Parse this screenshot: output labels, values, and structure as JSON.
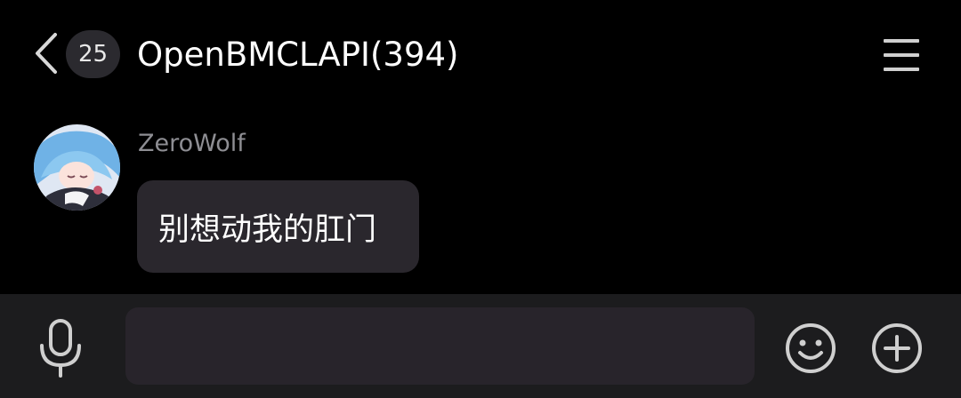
{
  "header": {
    "back_icon": "chevron-left-icon",
    "unread_count": "25",
    "title": "OpenBMCLAPI(394)",
    "menu_icon": "hamburger-menu-icon"
  },
  "messages": [
    {
      "sender": "ZeroWolf",
      "avatar_icon": "avatar-anime-blue-hair",
      "text": "别想动我的肛门"
    }
  ],
  "input_bar": {
    "mic_icon": "microphone-icon",
    "input_value": "",
    "input_placeholder": "",
    "emoji_icon": "smiley-icon",
    "plus_icon": "plus-circle-icon"
  },
  "colors": {
    "background": "#000000",
    "bubble": "#2a272d",
    "input_bar": "#1c1c1e",
    "input_field": "#28242b",
    "sender_name": "#8e8e93",
    "icon": "#cfcfcf"
  }
}
